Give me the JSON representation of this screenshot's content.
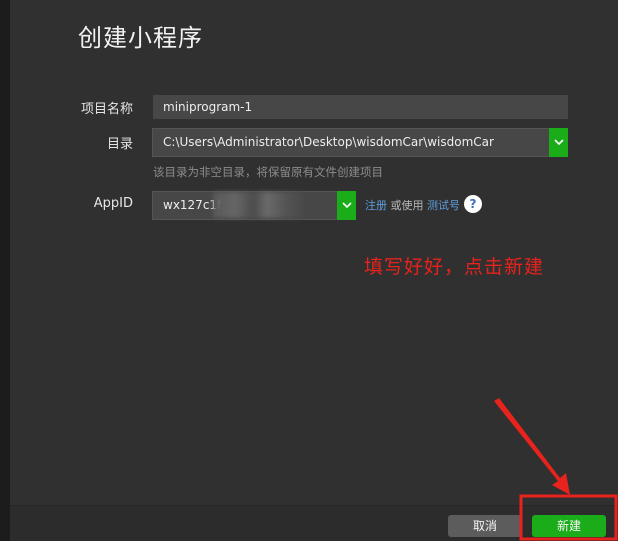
{
  "dialog": {
    "title": "创建小程序"
  },
  "form": {
    "project_name": {
      "label": "项目名称",
      "value": "miniprogram-1"
    },
    "directory": {
      "label": "目录",
      "value": "C:\\Users\\Administrator\\Desktop\\wisdomCar\\wisdomCar",
      "hint": "该目录为非空目录，将保留原有文件创建项目"
    },
    "appid": {
      "label": "AppID",
      "value": "wx127c1f",
      "register_link": "注册",
      "or_use_text": "或使用",
      "test_account_link": "测试号",
      "help_label": "?"
    }
  },
  "annotation": {
    "text": "填写好好，点击新建",
    "color": "#e8221c"
  },
  "footer": {
    "cancel_label": "取消",
    "create_label": "新建"
  },
  "colors": {
    "accent": "#1aad19",
    "link": "#5f9fe0",
    "annotation_red": "#e8221c"
  },
  "icons": {
    "dropdown": "chevron-down-icon",
    "help": "question-circle-icon",
    "arrow": "red-arrow"
  }
}
